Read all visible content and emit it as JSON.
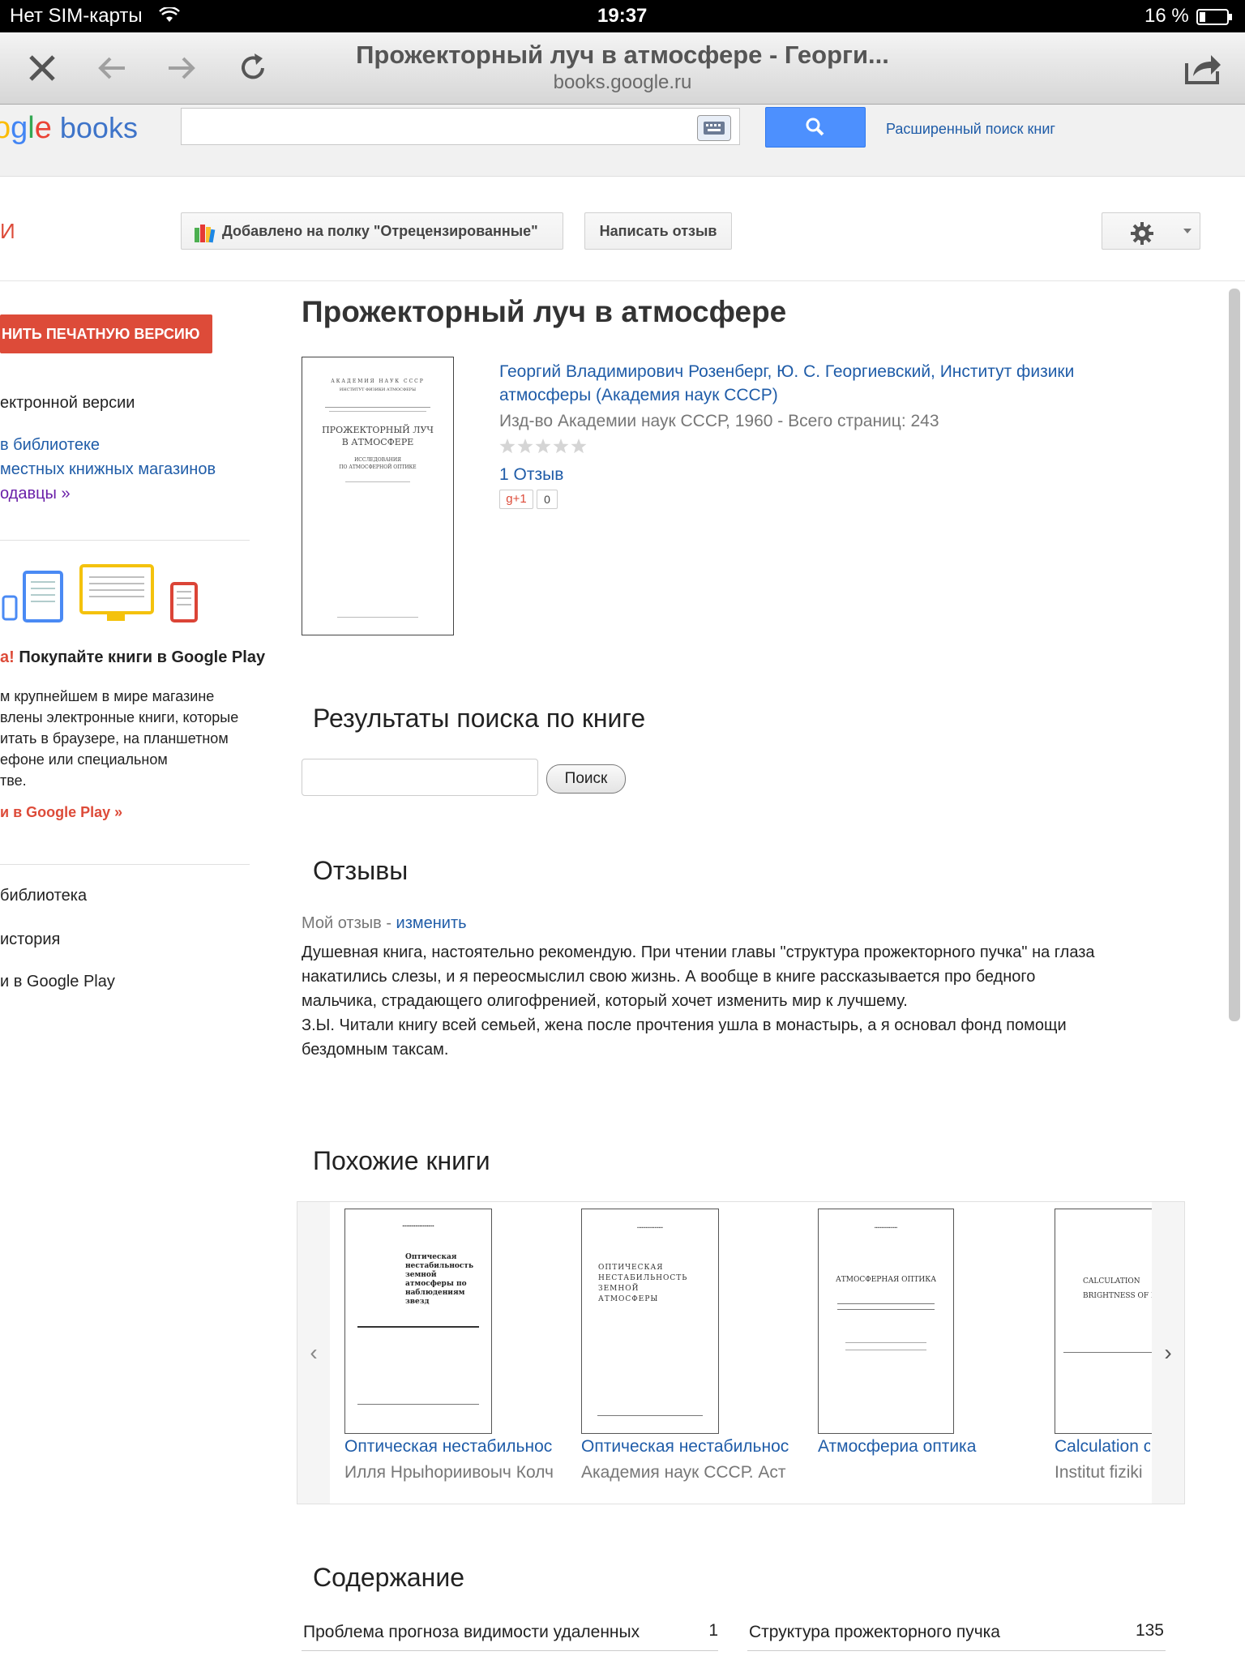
{
  "status_bar": {
    "carrier": "Нет SIM-карты",
    "time": "19:37",
    "battery": "16 %"
  },
  "browser": {
    "title": "Прожекторный луч в атмосфере - Георги...",
    "url": "books.google.ru"
  },
  "gb_header": {
    "logo_partial": "ogle",
    "logo_books": "books",
    "search_placeholder": "",
    "advanced_search": "Расширенный поиск книг"
  },
  "actions": {
    "left_partial": "И",
    "shelf_button": "Добавлено на полку \"Отрецензированные\"",
    "review_button": "Написать отзыв"
  },
  "sidebar": {
    "print_button": "НИТЬ ПЕЧАТНУЮ ВЕРСИЮ",
    "ebook_text": "ектронной версии",
    "library_link": "в библиотеке",
    "local_stores_link": "местных книжных магазинов",
    "sellers_link": "одавцы »",
    "promo_new": "а!",
    "promo_title": "Покупайте книги в Google Play",
    "promo_lines": [
      "м крупнейшем в мире магазине",
      "влены электронные книги, которые",
      "итать в браузере, на планшетном",
      "ефоне или специальном",
      "тве."
    ],
    "promo_link": "и в Google Play »",
    "nav": [
      "библиотека",
      "история",
      "и в Google Play"
    ]
  },
  "book": {
    "title": "Прожекторный луч в атмосфере",
    "cover_lines": [
      "АКАДЕМИЯ НАУК СССР",
      "ИНСТИТУТ ФИЗИКИ АТМОСФЕРЫ",
      "ПРОЖЕКТОРНЫЙ ЛУЧ",
      "В АТМОСФЕРЕ",
      "ИССЛЕДОВАНИЯ",
      "ПО АТМОСФЕРНОЙ ОПТИКЕ"
    ],
    "authors_line1": "Георгий Владимирович Розенберг, Ю. С. Георгиевский, Институт физики",
    "authors_line2": "атмосферы (Академия наук СССР)",
    "publisher": "Изд-во Академии наук СССР, 1960 - Всего страниц: 243",
    "rating": 0,
    "reviews_link": "1 Отзыв",
    "gplus": "g+1",
    "gplus_count": "0"
  },
  "search_in_book": {
    "heading": "Результаты поиска по книге",
    "button": "Поиск",
    "value": ""
  },
  "reviews": {
    "heading": "Отзывы",
    "my_review": "Мой отзыв",
    "separator": "-",
    "edit": "изменить",
    "text_lines": [
      "Душевная книга, настоятельно рекомендую. При чтении главы \"структура прожекторного пучка\" на глаза",
      "накатились слезы, и я переосмыслил свою жизнь. А вообще в книге рассказывается про бедного",
      "мальчика, страдающего олигофренией, который хочет изменить мир к лучшему.",
      "З.Ы. Читали книгу всей семьей, жена после прочтения ушла в монастырь, а я основал фонд помощи",
      "бездомным таксам."
    ]
  },
  "similar": {
    "heading": "Похожие книги",
    "prev": "‹",
    "next": "›",
    "books": [
      {
        "title": "Оптическая нестабильнос",
        "author": "Илля Нрыһориивоыч Колч",
        "cover": "Оптическая нестабильность земной атмосферы по наблюдениям звезд"
      },
      {
        "title": "Оптическая нестабильнос",
        "author": "Академия наук СССР. Аст",
        "cover": "ОПТИЧЕСКАЯ НЕСТАБИЛЬНОСТЬ ЗЕМНОЙ АТМОСФЕРЫ"
      },
      {
        "title": "Атмосфериа оптика",
        "author": "",
        "cover": "АТМОСФЕРНАЯ ОПТИКА"
      },
      {
        "title": "Calculation c",
        "author": "Institut fiziki",
        "cover": "CALCULATION BRIGHTNESS OF L"
      }
    ]
  },
  "toc": {
    "heading": "Содержание",
    "rows": [
      {
        "title": "Проблема прогноза видимости удаленных",
        "page": "1"
      },
      {
        "title": "Структура прожекторного пучка",
        "page": "135"
      }
    ]
  },
  "colors": {
    "accent_blue": "#4d90fe",
    "link": "#1f5ca8",
    "red_button": "#dd4b39"
  }
}
